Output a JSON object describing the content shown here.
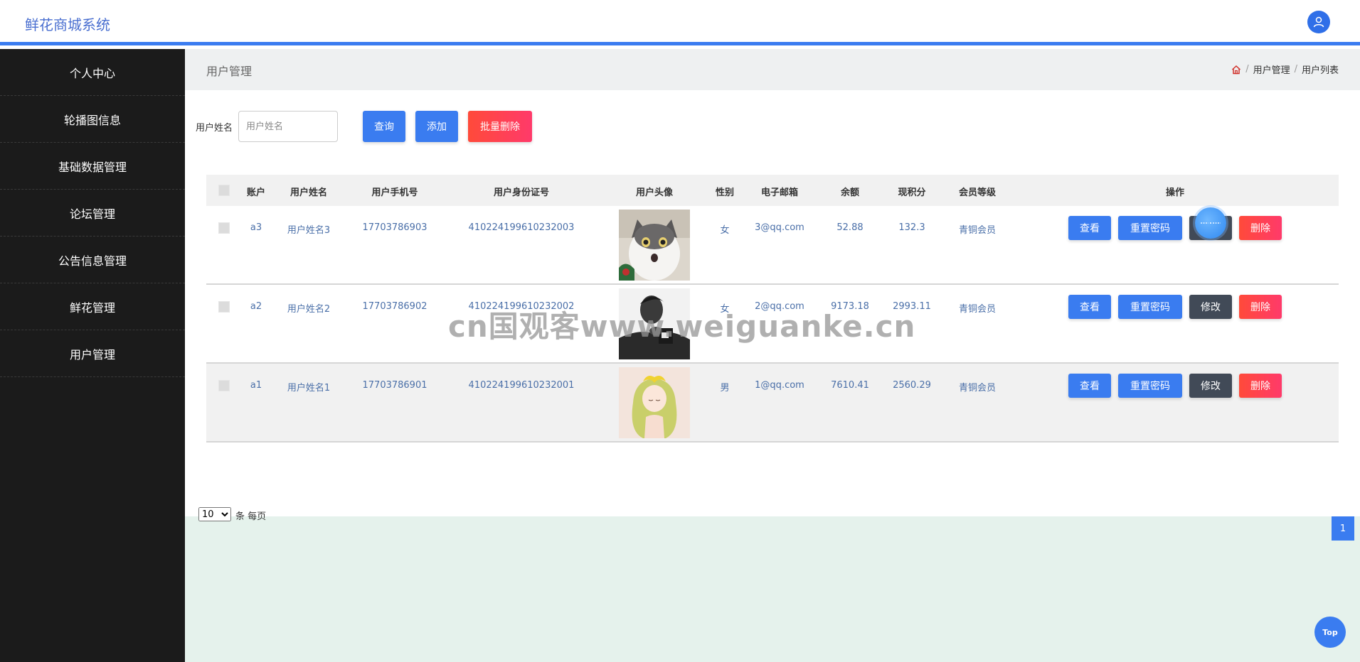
{
  "app": {
    "title": "鲜花商城系统"
  },
  "sidebar": {
    "items": [
      {
        "label": "个人中心"
      },
      {
        "label": "轮播图信息"
      },
      {
        "label": "基础数据管理"
      },
      {
        "label": "论坛管理"
      },
      {
        "label": "公告信息管理"
      },
      {
        "label": "鲜花管理"
      },
      {
        "label": "用户管理"
      }
    ]
  },
  "page": {
    "title": "用户管理",
    "breadcrumb": {
      "section": "用户管理",
      "current": "用户列表",
      "separator": "/"
    }
  },
  "search": {
    "label": "用户姓名",
    "placeholder": "用户姓名",
    "query_label": "查询",
    "add_label": "添加",
    "batch_delete_label": "批量删除"
  },
  "table": {
    "headers": {
      "account": "账户",
      "name": "用户姓名",
      "phone": "用户手机号",
      "id_card": "用户身份证号",
      "avatar": "用户头像",
      "gender": "性别",
      "email": "电子邮箱",
      "balance": "余额",
      "points": "现积分",
      "level": "会员等级",
      "actions": "操作"
    },
    "actions": {
      "view": "查看",
      "reset": "重置密码",
      "edit": "修改",
      "delete": "删除"
    },
    "rows": [
      {
        "account": "a3",
        "name": "用户姓名3",
        "phone": "17703786903",
        "id_card": "410224199610232003",
        "gender": "女",
        "email": "3@qq.com",
        "balance": "52.88",
        "points": "132.3",
        "level": "青铜会员"
      },
      {
        "account": "a2",
        "name": "用户姓名2",
        "phone": "17703786902",
        "id_card": "410224199610232002",
        "gender": "女",
        "email": "2@qq.com",
        "balance": "9173.18",
        "points": "2993.11",
        "level": "青铜会员"
      },
      {
        "account": "a1",
        "name": "用户姓名1",
        "phone": "17703786901",
        "id_card": "410224199610232001",
        "gender": "男",
        "email": "1@qq.com",
        "balance": "7610.41",
        "points": "2560.29",
        "level": "青铜会员"
      }
    ]
  },
  "pagination": {
    "page_size": "10",
    "page_size_options": [
      "10"
    ],
    "per_page_label": "条 每页",
    "current_page": "1"
  },
  "top_button": {
    "label": "Top"
  },
  "watermark": {
    "text": "cn国观客www.weiguanke.cn"
  },
  "colors": {
    "primary": "#3a7cf0",
    "danger": "#ff3a5a",
    "dark": "#414a57",
    "sidebar": "#1b1b1b",
    "brand": "#4a6fd0"
  }
}
